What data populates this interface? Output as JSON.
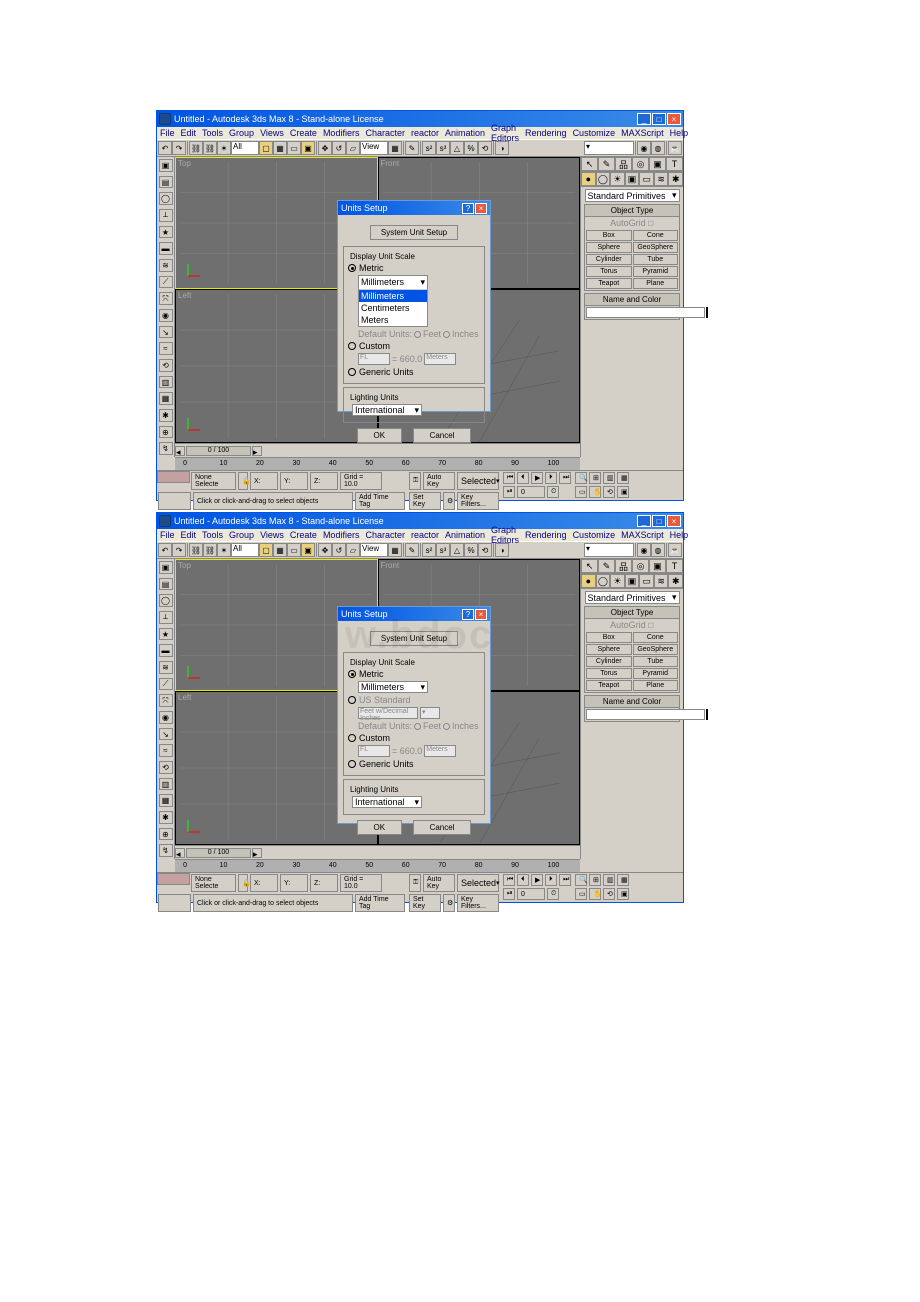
{
  "window_title": "Untitled - Autodesk 3ds Max 8  - Stand-alone License",
  "menu": [
    "File",
    "Edit",
    "Tools",
    "Group",
    "Views",
    "Create",
    "Modifiers",
    "Character",
    "reactor",
    "Animation",
    "Graph Editors",
    "Rendering",
    "Customize",
    "MAXScript",
    "Help"
  ],
  "viewport_labels": {
    "tl": "Top",
    "tr": "Front",
    "bl": "Left",
    "br": ""
  },
  "toolbar_selset": "All",
  "toolbar_view": "View",
  "command_panel": {
    "category": "Standard Primitives",
    "rollout1": "Object Type",
    "autogrid": "AutoGrid",
    "prims": [
      "Box",
      "Cone",
      "Sphere",
      "GeoSphere",
      "Cylinder",
      "Tube",
      "Torus",
      "Pyramid",
      "Teapot",
      "Plane"
    ],
    "rollout2": "Name and Color"
  },
  "time": {
    "slider": "0 / 100",
    "ticks": [
      "0",
      "10",
      "20",
      "30",
      "40",
      "50",
      "60",
      "70",
      "80",
      "90",
      "100"
    ]
  },
  "status": {
    "coord": "None Selecte",
    "x": "X:",
    "y": "Y:",
    "z": "Z:",
    "grid": "Grid = 10.0",
    "prompt": "Click or click-and-drag to select objects",
    "addtag": "Add Time Tag",
    "autokey": "Auto Key",
    "setkey": "Set Key",
    "selected": "Selected",
    "keyfilters": "Key Filters...",
    "frame": "0"
  },
  "dialog": {
    "title": "Units Setup",
    "sys_btn": "System Unit Setup",
    "f1": "Display Unit Scale",
    "metric": "Metric",
    "metric_unit": "Millimeters",
    "metric_opts": [
      "Millimeters",
      "Centimeters",
      "Meters"
    ],
    "us": "US Standard",
    "us_unit": "Feet w/Decimal Inches",
    "defu": "Default Units:",
    "feet": "Feet",
    "inches": "Inches",
    "custom": "Custom",
    "custom_a": "FL",
    "custom_b": "= 660.0",
    "custom_c": "Meters",
    "generic": "Generic Units",
    "f2": "Lighting Units",
    "lu": "International",
    "ok": "OK",
    "cancel": "Cancel"
  }
}
